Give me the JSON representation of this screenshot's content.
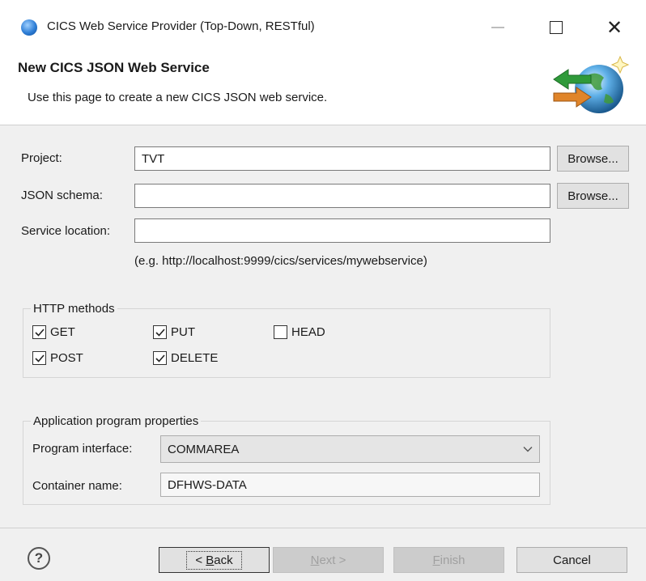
{
  "window": {
    "title": "CICS Web Service Provider (Top-Down, RESTful)",
    "minimize_label": "—",
    "close_label": "✕"
  },
  "banner": {
    "title": "New CICS JSON Web Service",
    "description": "Use this page to create a new CICS JSON web service."
  },
  "form": {
    "project_label": "Project:",
    "project_value": "TVT",
    "json_schema_label": "JSON schema:",
    "json_schema_value": "",
    "service_location_label": "Service location:",
    "service_location_value": "",
    "service_location_hint": "(e.g. http://localhost:9999/cics/services/mywebservice)",
    "browse_label": "Browse..."
  },
  "http_methods": {
    "legend": "HTTP methods",
    "items": [
      {
        "label": "GET",
        "checked": true
      },
      {
        "label": "PUT",
        "checked": true
      },
      {
        "label": "HEAD",
        "checked": false
      },
      {
        "label": "POST",
        "checked": true
      },
      {
        "label": "DELETE",
        "checked": true
      }
    ]
  },
  "app_props": {
    "legend": "Application program properties",
    "program_interface_label": "Program interface:",
    "program_interface_value": "COMMAREA",
    "container_name_label": "Container name:",
    "container_name_value": "DFHWS-DATA"
  },
  "footer": {
    "help_label": "?",
    "back_prefix": "< ",
    "back_mnemonic": "B",
    "back_rest": "ack",
    "next_mnemonic": "N",
    "next_rest": "ext >",
    "finish_mnemonic": "F",
    "finish_rest": "inish",
    "cancel_label": "Cancel"
  },
  "colors": {
    "background": "#f0f0f0",
    "title_icon": "#2e7ed6",
    "disabled_text": "#a0a0a0"
  },
  "icons": {
    "title": "cics-globe-icon",
    "banner": "globe-arrows-wizard-icon",
    "help": "help-icon",
    "dropdown": "chevron-down-icon"
  }
}
